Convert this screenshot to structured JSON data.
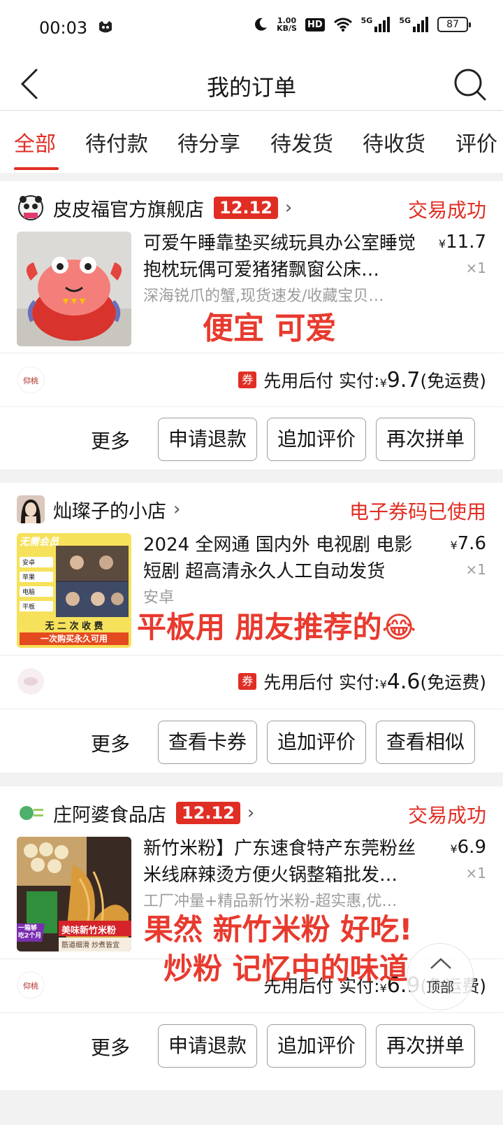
{
  "status_bar": {
    "time": "00:03",
    "speed_value": "1.00",
    "speed_unit": "KB/S",
    "hd_label": "HD",
    "network_1": "5G",
    "network_2": "5G",
    "battery": "87"
  },
  "header": {
    "title": "我的订单"
  },
  "tabs": [
    "全部",
    "待付款",
    "待分享",
    "待发货",
    "待收货",
    "评价"
  ],
  "orders": [
    {
      "shop_name": "皮皮福官方旗舰店",
      "badge": "12.12",
      "status": "交易成功",
      "product_title": "可爱午睡靠垫买绒玩具办公室睡觉抱枕玩偶可爱猪猪飘窗公床…",
      "spec": "深海锐爪的蟹,现货速发/收藏宝贝…",
      "price_symbol": "¥",
      "price": "11.7",
      "qty": "×1",
      "annotation": "便宜 可爱",
      "mini_logo_text": "仰桃",
      "coupon_tag": "券",
      "pay_label": "先用后付 实付: ",
      "pay_symbol": "¥",
      "pay_amount": "9.7",
      "pay_note": "(免运费)",
      "more": "更多",
      "buttons": [
        "申请退款",
        "追加评价",
        "再次拼单"
      ]
    },
    {
      "shop_name": "灿璨子的小店",
      "status": "电子券码已使用",
      "product_title": "2024 全网通 国内外 电视剧 电影 短剧 超高清永久人工自动发货",
      "spec": "安卓",
      "price_symbol": "¥",
      "price": "7.6",
      "qty": "×1",
      "annotation": "平板用 朋友推荐的😂",
      "thumb_header": "无需会员",
      "thumb_items": [
        "安卓",
        "苹果",
        "电脑",
        "平板"
      ],
      "thumb_footer_1": "无 二 次 收 费",
      "thumb_footer_2": "一次购买永久可用",
      "coupon_tag": "券",
      "pay_label": "先用后付 实付: ",
      "pay_symbol": "¥",
      "pay_amount": "4.6",
      "pay_note": "(免运费)",
      "more": "更多",
      "buttons": [
        "查看卡券",
        "追加评价",
        "查看相似"
      ]
    },
    {
      "shop_name": "庄阿婆食品店",
      "badge": "12.12",
      "status": "交易成功",
      "product_title": "新竹米粉】广东速食特产东莞粉丝米线麻辣烫方便火锅整箱批发…",
      "spec": "工厂冲量+精品新竹米粉-超实惠,优…",
      "price_symbol": "¥",
      "price": "6.9",
      "qty": "×1",
      "annotation_line1": "果然 新竹米粉 好吃!",
      "annotation_line2": "炒粉 记忆中的味道",
      "thumb_ribbon": "美味新竹米粉",
      "thumb_corner": "一箱够 吃2个月",
      "thumb_bottom": "筋道细滑 炒煮皆宜",
      "mini_logo_text": "仰桃",
      "pay_label": "先用后付 实付: ",
      "pay_symbol": "¥",
      "pay_amount": "6.9",
      "pay_note": "(免运费)",
      "more": "更多",
      "buttons": [
        "申请退款",
        "追加评价",
        "再次拼单"
      ]
    }
  ],
  "to_top": "顶部",
  "icons": [
    "back-icon",
    "search-icon",
    "chevron-right-icon",
    "coupon-icon",
    "wifi-icon",
    "signal-icon",
    "moon-icon",
    "battery-icon",
    "up-arrow-icon"
  ],
  "colors": {
    "accent": "#e02e24",
    "annotation": "#e83a2e",
    "muted": "#9c9c9c"
  }
}
